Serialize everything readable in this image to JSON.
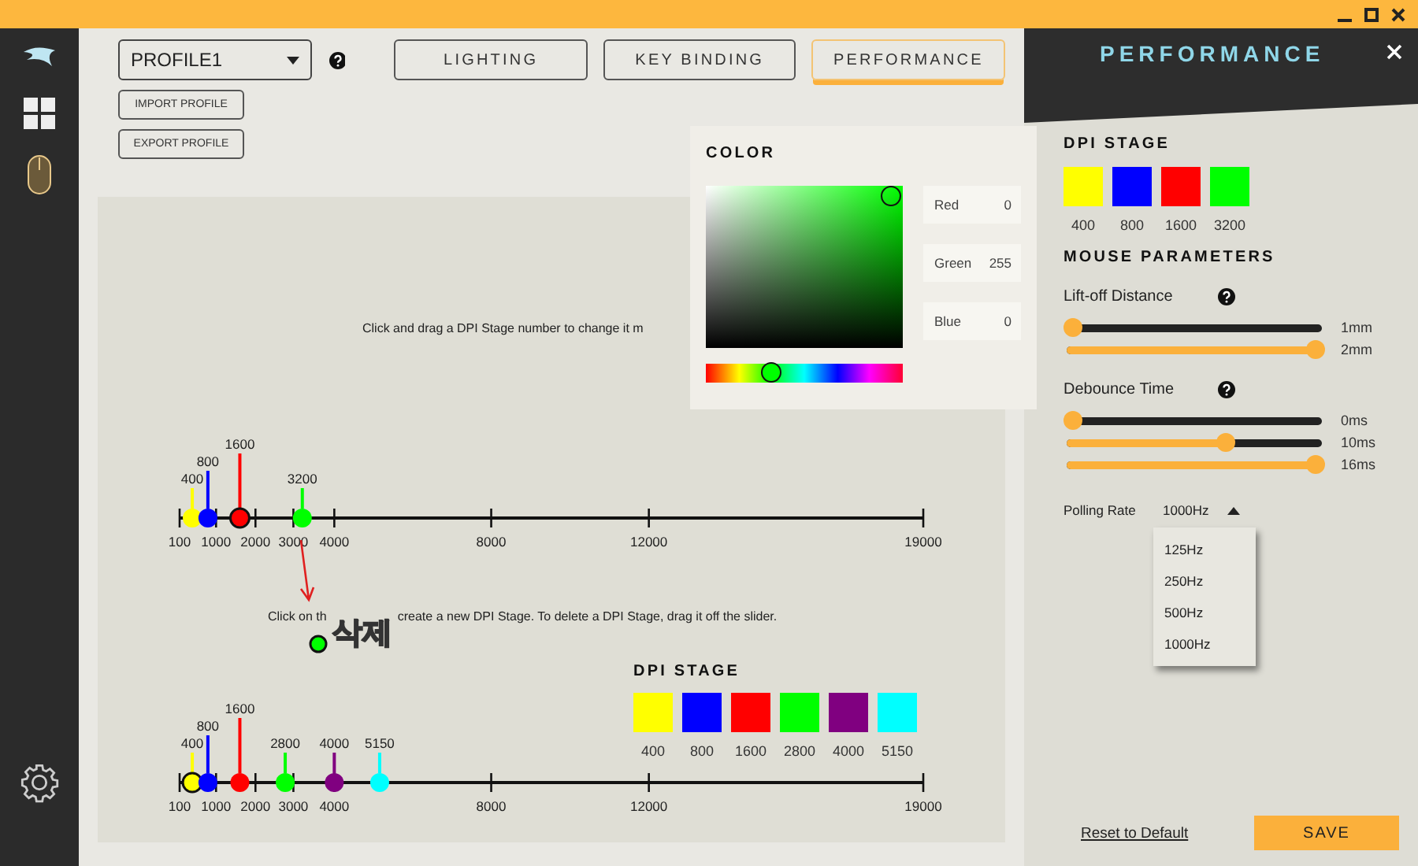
{
  "profile": {
    "value": "PROFILE1"
  },
  "profile_buttons": [
    "IMPORT PROFILE",
    "EXPORT PROFILE"
  ],
  "tabs": [
    {
      "label": "LIGHTING",
      "selected": false
    },
    {
      "label": "KEY BINDING",
      "selected": false
    },
    {
      "label": "PERFORMANCE",
      "selected": true
    }
  ],
  "editor": {
    "hint_top": "Click and drag a DPI Stage number to change it m",
    "top_slider": {
      "ticks": [
        "100",
        "1000",
        "2000",
        "3000",
        "4000",
        "8000",
        "12000",
        "19000"
      ],
      "stages": [
        {
          "value": "400",
          "color": "#ffff00",
          "level": 0.017,
          "selected": false
        },
        {
          "value": "800",
          "color": "#0000ff",
          "level": 0.038,
          "selected": false
        },
        {
          "value": "1600",
          "color": "#ff0000",
          "level": 0.081,
          "selected": true
        },
        {
          "value": "3200",
          "color": "#00ff00",
          "level": 0.165,
          "selected": false
        }
      ]
    },
    "hint_middle": [
      "Click on th",
      "create a new DPI Stage. To delete a DPI Stage, drag it off the slider."
    ],
    "annotation": {
      "text": "삭제"
    },
    "dpi_stage": {
      "heading": "DPI STAGE",
      "swatches": [
        {
          "label": "400",
          "color": "#ffff00"
        },
        {
          "label": "800",
          "color": "#0000ff"
        },
        {
          "label": "1600",
          "color": "#ff0000"
        },
        {
          "label": "2800",
          "color": "#00ff00"
        },
        {
          "label": "4000",
          "color": "#800080"
        },
        {
          "label": "5150",
          "color": "#00ffff"
        }
      ]
    },
    "bottom_slider": {
      "ticks": [
        "100",
        "1000",
        "2000",
        "3000",
        "4000",
        "8000",
        "12000",
        "19000"
      ],
      "stages": [
        {
          "value": "400",
          "color": "#ffff00",
          "level": 0.017,
          "selected": true
        },
        {
          "value": "800",
          "color": "#0000ff",
          "level": 0.038,
          "selected": false
        },
        {
          "value": "1600",
          "color": "#ff0000",
          "level": 0.081,
          "selected": false
        },
        {
          "value": "2800",
          "color": "#00ff00",
          "level": 0.142,
          "selected": false
        },
        {
          "value": "4000",
          "color": "#800080",
          "level": 0.208,
          "selected": false
        },
        {
          "value": "5150",
          "color": "#00ffff",
          "level": 0.269,
          "selected": false
        }
      ]
    }
  },
  "color_picker": {
    "title": "COLOR",
    "fields": [
      {
        "label": "Red",
        "value": "0"
      },
      {
        "label": "Green",
        "value": "255"
      },
      {
        "label": "Blue",
        "value": "0"
      }
    ]
  },
  "panel": {
    "title": "PERFORMANCE",
    "dpi_heading": "DPI STAGE",
    "swatches": [
      {
        "label": "400",
        "color": "#ffff00"
      },
      {
        "label": "800",
        "color": "#0000ff"
      },
      {
        "label": "1600",
        "color": "#ff0000"
      },
      {
        "label": "3200",
        "color": "#00ff00"
      }
    ],
    "params_heading": "MOUSE PARAMETERS",
    "groups": [
      {
        "label": "Lift-off Distance",
        "sliders": [
          {
            "level": 0,
            "reading": "1mm"
          },
          {
            "level": 1,
            "reading": "2mm"
          }
        ]
      },
      {
        "label": "Debounce Time",
        "sliders": [
          {
            "level": 0,
            "reading": "0ms"
          },
          {
            "level": 0.63,
            "reading": "10ms"
          },
          {
            "level": 1,
            "reading": "16ms"
          }
        ]
      }
    ],
    "polling": {
      "label": "Polling Rate",
      "value": "1000Hz",
      "expanded": true,
      "options": [
        "125Hz",
        "250Hz",
        "500Hz",
        "1000Hz"
      ]
    },
    "reset": "Reset to Default",
    "save": "SAVE"
  }
}
